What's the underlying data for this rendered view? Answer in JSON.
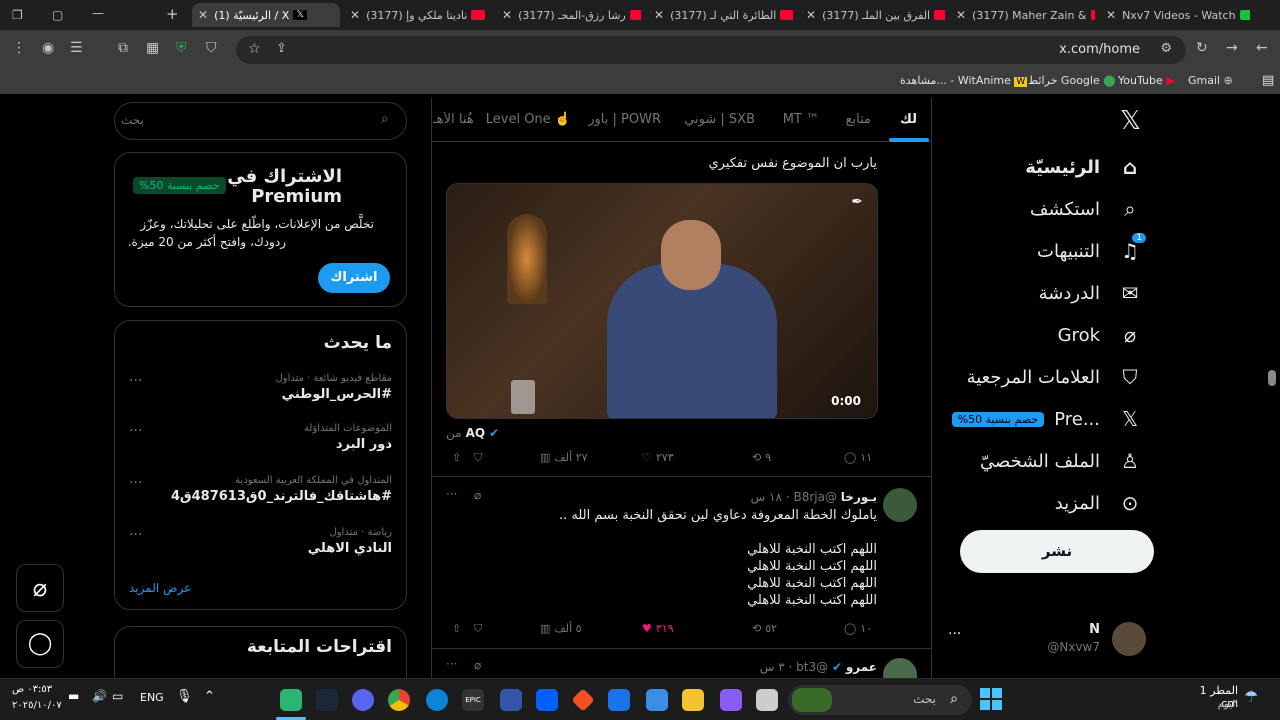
{
  "tabs": [
    {
      "label": "Nxv7 Videos - Watch"
    },
    {
      "label": "(3177) Maher Zain &"
    },
    {
      "label": "(3177) الفرق بين الملـ"
    },
    {
      "label": "(3177) الطائرة التي لـ"
    },
    {
      "label": "(3177) رشا رزق-المحـ"
    },
    {
      "label": "(3177) ناديتا ملكي وإ"
    },
    {
      "label": "(1) الرئيسيّة / X"
    }
  ],
  "url": "x.com/home",
  "bookmarks": [
    "Gmail",
    "YouTube",
    "خرائط Google",
    "مشاهدة... - WitAnime"
  ],
  "nav": {
    "home": "الرئيسيّة",
    "explore": "استكشف",
    "notifications": "التنبيهات",
    "notif_count": "1",
    "chat": "الدردشة",
    "grok": "Grok",
    "bookmarks": "العلامات المرجعية",
    "premium": "Pre...",
    "premium_badge": "%حصم بنسبة 50",
    "profile": "الملف الشخصيّ",
    "more": "المزيد",
    "post_button": "نشر",
    "account_name": "N",
    "account_handle": "@Nxvw7"
  },
  "feed_tabs": [
    "لك",
    "متابع",
    "MT ™",
    "شوني | SXB",
    "باور | POWR",
    "Level One ☝️",
    "هُنا الأهـ"
  ],
  "tweet1": {
    "text": "يارب ان الموضوع نفس تفكيري",
    "video_time": "0:00",
    "ad_label": "من",
    "ad_name": "AQ",
    "replies": "١١",
    "retweets": "٩",
    "likes": "٢٧٣",
    "views": "٢٧ ألف"
  },
  "tweet2": {
    "name": "بـورخا",
    "handle": "@B8rja",
    "time": "١٨ س",
    "line1": "ياملوك الخطة المعروفة دعاوي لين تحقق النخبة بسم الله ..",
    "line2": "اللهم اكتب النخبة للاهلي",
    "line3": "اللهم اكتب النخبة للاهلي",
    "line4": "اللهم اكتب النخبة للاهلي",
    "line5": "اللهم اكتب النخبة للاهلي",
    "replies": "١٠",
    "retweets": "٥٢",
    "likes": "٣١٩",
    "views": "٥ ألف"
  },
  "tweet3": {
    "name": "عمرو",
    "handle": "@bt3",
    "time": "٣ س"
  },
  "search": {
    "placeholder": "بحث"
  },
  "premium": {
    "title": "الاشتراك في Premium",
    "badge": "%حصم بنسبة 50",
    "desc1": "تخلَّص من الإعلانات، واطّلع على تحليلاتك، وعزّز",
    "desc2": "ردودك، وافتح أكثر من 20 ميزة.",
    "button": "اشتراك"
  },
  "trending": {
    "title": "ما يحدث",
    "items": [
      {
        "meta": "مقاطع فيديو شائعة · متداول",
        "name": "#الحرس_الوطني"
      },
      {
        "meta": "الموضوعات المتداوَلة",
        "name": "دور البرد"
      },
      {
        "meta": "المتداول في المملكة العربية السعودية",
        "name": "#هاشتاقك_فالترند_0ق487613ق4"
      },
      {
        "meta": "رياضة · متداول",
        "name": "النادي الاهلي"
      }
    ],
    "show_more": "عرض المزيد"
  },
  "follow": {
    "title": "اقتراحات المتابعة"
  },
  "taskbar": {
    "weather": "المطر 1 cm",
    "weather_sub": "اليوم",
    "search": "بحث",
    "lang": "ENG",
    "time": "٠٣:٥٣ ص",
    "date": "٢٠٢٥/١٠/٠٧"
  },
  "colors": {
    "accent": "#1d9bf0",
    "like": "#f91880",
    "badge_green": "#00ba7c"
  }
}
